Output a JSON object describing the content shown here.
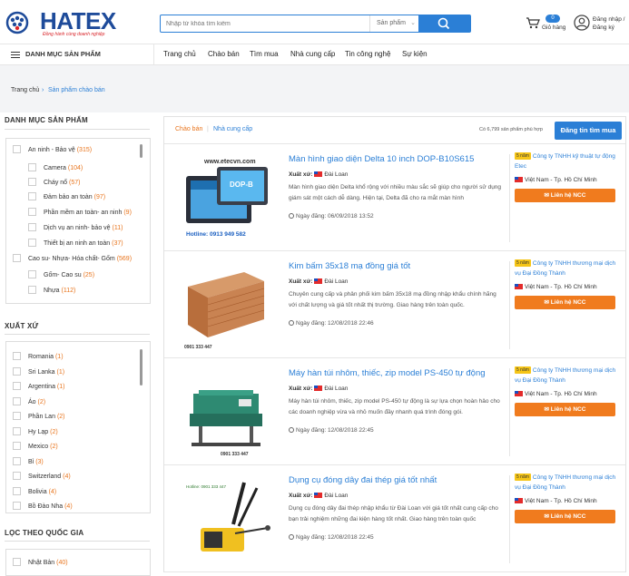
{
  "header": {
    "logo_text": "HATEX",
    "logo_slogan": "Đồng hành cùng doanh nghiệp",
    "search_placeholder": "Nhập từ khóa tìm kiếm",
    "search_type": "Sản phẩm",
    "cart_count": "0",
    "cart_label": "Giỏ hàng",
    "login_label": "Đăng nhập /",
    "register_label": "Đăng ký"
  },
  "nav": {
    "category_label": "DANH MỤC SẢN PHẨM",
    "menu": [
      "Trang chủ",
      "Chào bán",
      "Tìm mua",
      "Nhà cung cấp",
      "Tin công nghệ",
      "Sự kiện"
    ]
  },
  "breadcrumb": {
    "home": "Trang chủ",
    "separator": "›",
    "current": "Sản phẩm chào bán"
  },
  "sidebar": {
    "categories_title": "DANH MỤC SẢN PHẨM",
    "categories": [
      {
        "label": "An ninh - Bảo vệ",
        "count": "(315)"
      },
      {
        "label": "Camera",
        "count": "(104)"
      },
      {
        "label": "Cháy nổ",
        "count": "(57)"
      },
      {
        "label": "Đảm bảo an toàn",
        "count": "(97)"
      },
      {
        "label": "Phần mềm an toàn- an ninh",
        "count": "(9)"
      },
      {
        "label": "Dịch vụ an ninh- bảo vệ",
        "count": "(11)"
      },
      {
        "label": "Thiết bị an ninh an toàn",
        "count": "(37)"
      },
      {
        "label": "Cao su- Nhựa- Hóa chất- Gốm",
        "count": "(569)"
      },
      {
        "label": "Gốm- Cao su",
        "count": "(25)"
      },
      {
        "label": "Nhựa",
        "count": "(112)"
      }
    ],
    "origin_title": "XUẤT XỨ",
    "origins": [
      {
        "label": "Romania",
        "count": "(1)"
      },
      {
        "label": "Sri Lanka",
        "count": "(1)"
      },
      {
        "label": "Argentina",
        "count": "(1)"
      },
      {
        "label": "Áo",
        "count": "(2)"
      },
      {
        "label": "Phần Lan",
        "count": "(2)"
      },
      {
        "label": "Hy Lạp",
        "count": "(2)"
      },
      {
        "label": "Mexico",
        "count": "(2)"
      },
      {
        "label": "Bỉ",
        "count": "(3)"
      },
      {
        "label": "Switzerland",
        "count": "(4)"
      },
      {
        "label": "Bolivia",
        "count": "(4)"
      },
      {
        "label": "Bồ Đào Nha",
        "count": "(4)"
      }
    ],
    "country_title": "LỌC THEO QUỐC GIA",
    "countries": [
      {
        "label": "Nhật Bản",
        "count": "(40)"
      }
    ]
  },
  "main": {
    "tab_offer": "Chào bán",
    "tab_sep": "|",
    "tab_supplier": "Nhà cung cấp",
    "result_count": "Có 6,799 sản phẩm phù hợp",
    "register_button": "Đăng tin tìm mua",
    "origin_label": "Xuất xứ:",
    "contact_label": "Liên hệ NCC",
    "products": [
      {
        "title": "Màn hình giao diện Delta 10 inch DOP-B10S615",
        "origin": "Đài Loan",
        "desc": "Màn hình giao diện Delta khổ rộng với nhiều màu sắc sẽ giúp cho người sử dụng giám sát một cách dễ dàng. Hiện tại, Delta đã cho ra mắt màn hình",
        "date": "Ngày đăng: 06/09/2018 13:52",
        "years": "5 năm",
        "company": "Công ty TNHH kỹ thuật tự động Etec",
        "location": "Việt Nam - Tp. Hồ Chí Minh",
        "img_caption": "www.etecvn.com",
        "img_hotline": "Hotline: 0913 949 582"
      },
      {
        "title": "Kim bấm 35x18 mạ đồng giá tốt",
        "origin": "Đài Loan",
        "desc": "Chuyên cung cấp và phân phối kim bấm 35x18 mạ đồng nhập khẩu chính hãng với chất lượng và giá tốt nhất thị trường. Giao hàng trên toàn quốc.",
        "date": "Ngày đăng: 12/08/2018 22:46",
        "years": "5 năm",
        "company": "Công ty TNHH thương mại dịch vụ Đại Đồng Thành",
        "location": "Việt Nam - Tp. Hồ Chí Minh",
        "img_caption": "0901 333 447"
      },
      {
        "title": "Máy hàn túi nhôm, thiếc, zip model PS-450 tự động",
        "origin": "Đài Loan",
        "desc": "Máy hàn túi nhôm, thiếc, zip model PS-450 tự động là sự lựa chọn hoàn hảo cho các doanh nghiệp vừa và nhỏ muốn đầy nhanh quá trình đóng gói.",
        "date": "Ngày đăng: 12/08/2018 22:45",
        "years": "5 năm",
        "company": "Công ty TNHH thương mại dịch vụ Đại Đồng Thành",
        "location": "Việt Nam - Tp. Hồ Chí Minh",
        "img_caption": "0901 333 447"
      },
      {
        "title": "Dụng cụ đóng dây đai thép giá tốt nhất",
        "origin": "Đài Loan",
        "desc": "Dụng cụ đóng dây đai thép nhập khẩu từ Đài Loan với giá tốt nhất cung cấp cho bạn trải nghiệm những đai kiện hàng tốt nhất. Giao hàng trên toàn quốc",
        "date": "Ngày đăng: 12/08/2018 22:45",
        "years": "5 năm",
        "company": "Công ty TNHH thương mại dịch vụ Đại Đồng Thành",
        "location": "Việt Nam - Tp. Hồ Chí Minh",
        "img_caption": "Hotline: 0901 333 447"
      }
    ]
  },
  "colors": {
    "primary": "#2b7fd6",
    "accent": "#f07b1e",
    "count": "#e8741c",
    "logo": "#1e4b9a"
  }
}
